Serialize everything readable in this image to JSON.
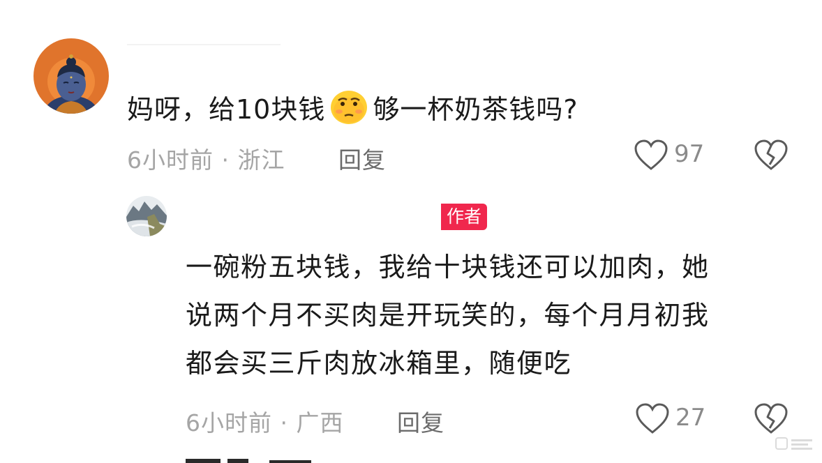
{
  "comments": [
    {
      "text_part1": "妈呀，给10块钱",
      "emoji": "smirk-face-emoji",
      "text_part2": "够一杯奶茶钱吗?",
      "meta": "6小时前 · 浙江",
      "reply_label": "回复",
      "like_count": "97"
    }
  ],
  "reply": {
    "author_badge": "作者",
    "lines": [
      "一碗粉五块钱，我给十块钱还可以加肉，她",
      "说两个月不买肉是开玩笑的，每个月月初我",
      "都会买三斤肉放冰箱里，随便吃"
    ],
    "meta": "6小时前 · 广西",
    "reply_label": "回复",
    "like_count": "27"
  },
  "icons": {
    "like": "heart-outline-icon",
    "dislike": "broken-heart-icon"
  },
  "colors": {
    "badge": "#f0274d",
    "meta": "#a5a5a5",
    "reply": "#6b6b6b"
  }
}
